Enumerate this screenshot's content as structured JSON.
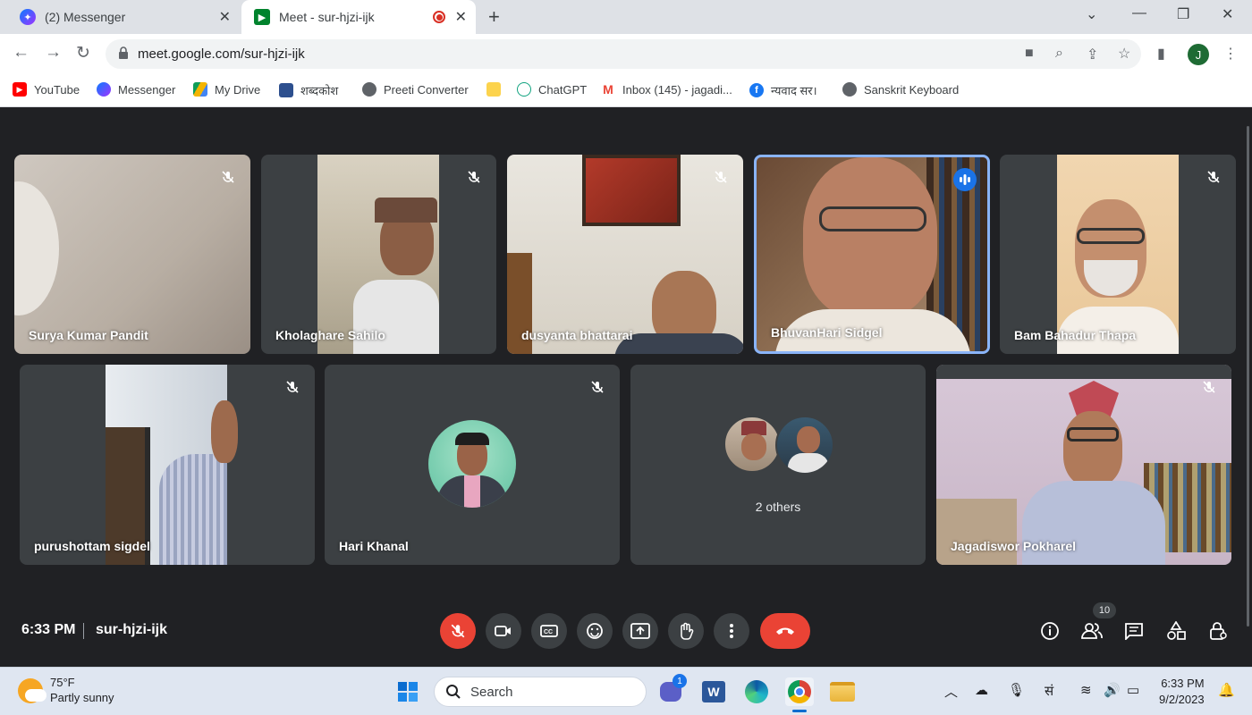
{
  "browser": {
    "tabs": [
      {
        "label": "(2) Messenger",
        "icon": "messenger-icon"
      },
      {
        "label": "Meet - sur-hjzi-ijk",
        "icon": "meet-icon",
        "active": true
      }
    ],
    "url": "meet.google.com/sur-hjzi-ijk",
    "profile_initial": "J",
    "bookmarks": [
      {
        "label": "YouTube",
        "icon": "youtube-icon"
      },
      {
        "label": "Messenger",
        "icon": "messenger-icon"
      },
      {
        "label": "My Drive",
        "icon": "drive-icon"
      },
      {
        "label": "शब्दकोश",
        "icon": "dictionary-icon"
      },
      {
        "label": "Preeti Converter",
        "icon": "globe-icon"
      },
      {
        "label": "",
        "icon": "folder-icon"
      },
      {
        "label": "ChatGPT",
        "icon": "chatgpt-icon"
      },
      {
        "label": "Inbox (145) - jagadi...",
        "icon": "gmail-icon"
      },
      {
        "label": "न्यवाद सर।",
        "icon": "facebook-icon"
      },
      {
        "label": "Sanskrit Keyboard",
        "icon": "globe-icon"
      }
    ]
  },
  "meeting": {
    "participants": [
      {
        "name": "Surya Kumar Pandit",
        "muted": true
      },
      {
        "name": "Kholaghare Sahilo",
        "muted": true
      },
      {
        "name": "dusyanta bhattarai",
        "muted": true
      },
      {
        "name": "BhuvanHari Sidgel",
        "speaking": true
      },
      {
        "name": "Bam Bahadur Thapa",
        "muted": true
      },
      {
        "name": "purushottam sigdel",
        "muted": true
      },
      {
        "name": "Hari Khanal",
        "muted": true
      },
      {
        "name": "2 others"
      },
      {
        "name": "Jagadiswor Pokharel",
        "muted": true
      }
    ],
    "time": "6:33 PM",
    "code": "sur-hjzi-ijk",
    "people_count": "10",
    "colors": {
      "end_call": "#ea4335",
      "speaking": "#1a73e8",
      "active_border": "#8ab4f8"
    }
  },
  "taskbar": {
    "weather_temp": "75°F",
    "weather_desc": "Partly sunny",
    "search_label": "Search",
    "teams_badge": "1",
    "ime_label": "सं",
    "clock_time": "6:33 PM",
    "clock_date": "9/2/2023"
  }
}
